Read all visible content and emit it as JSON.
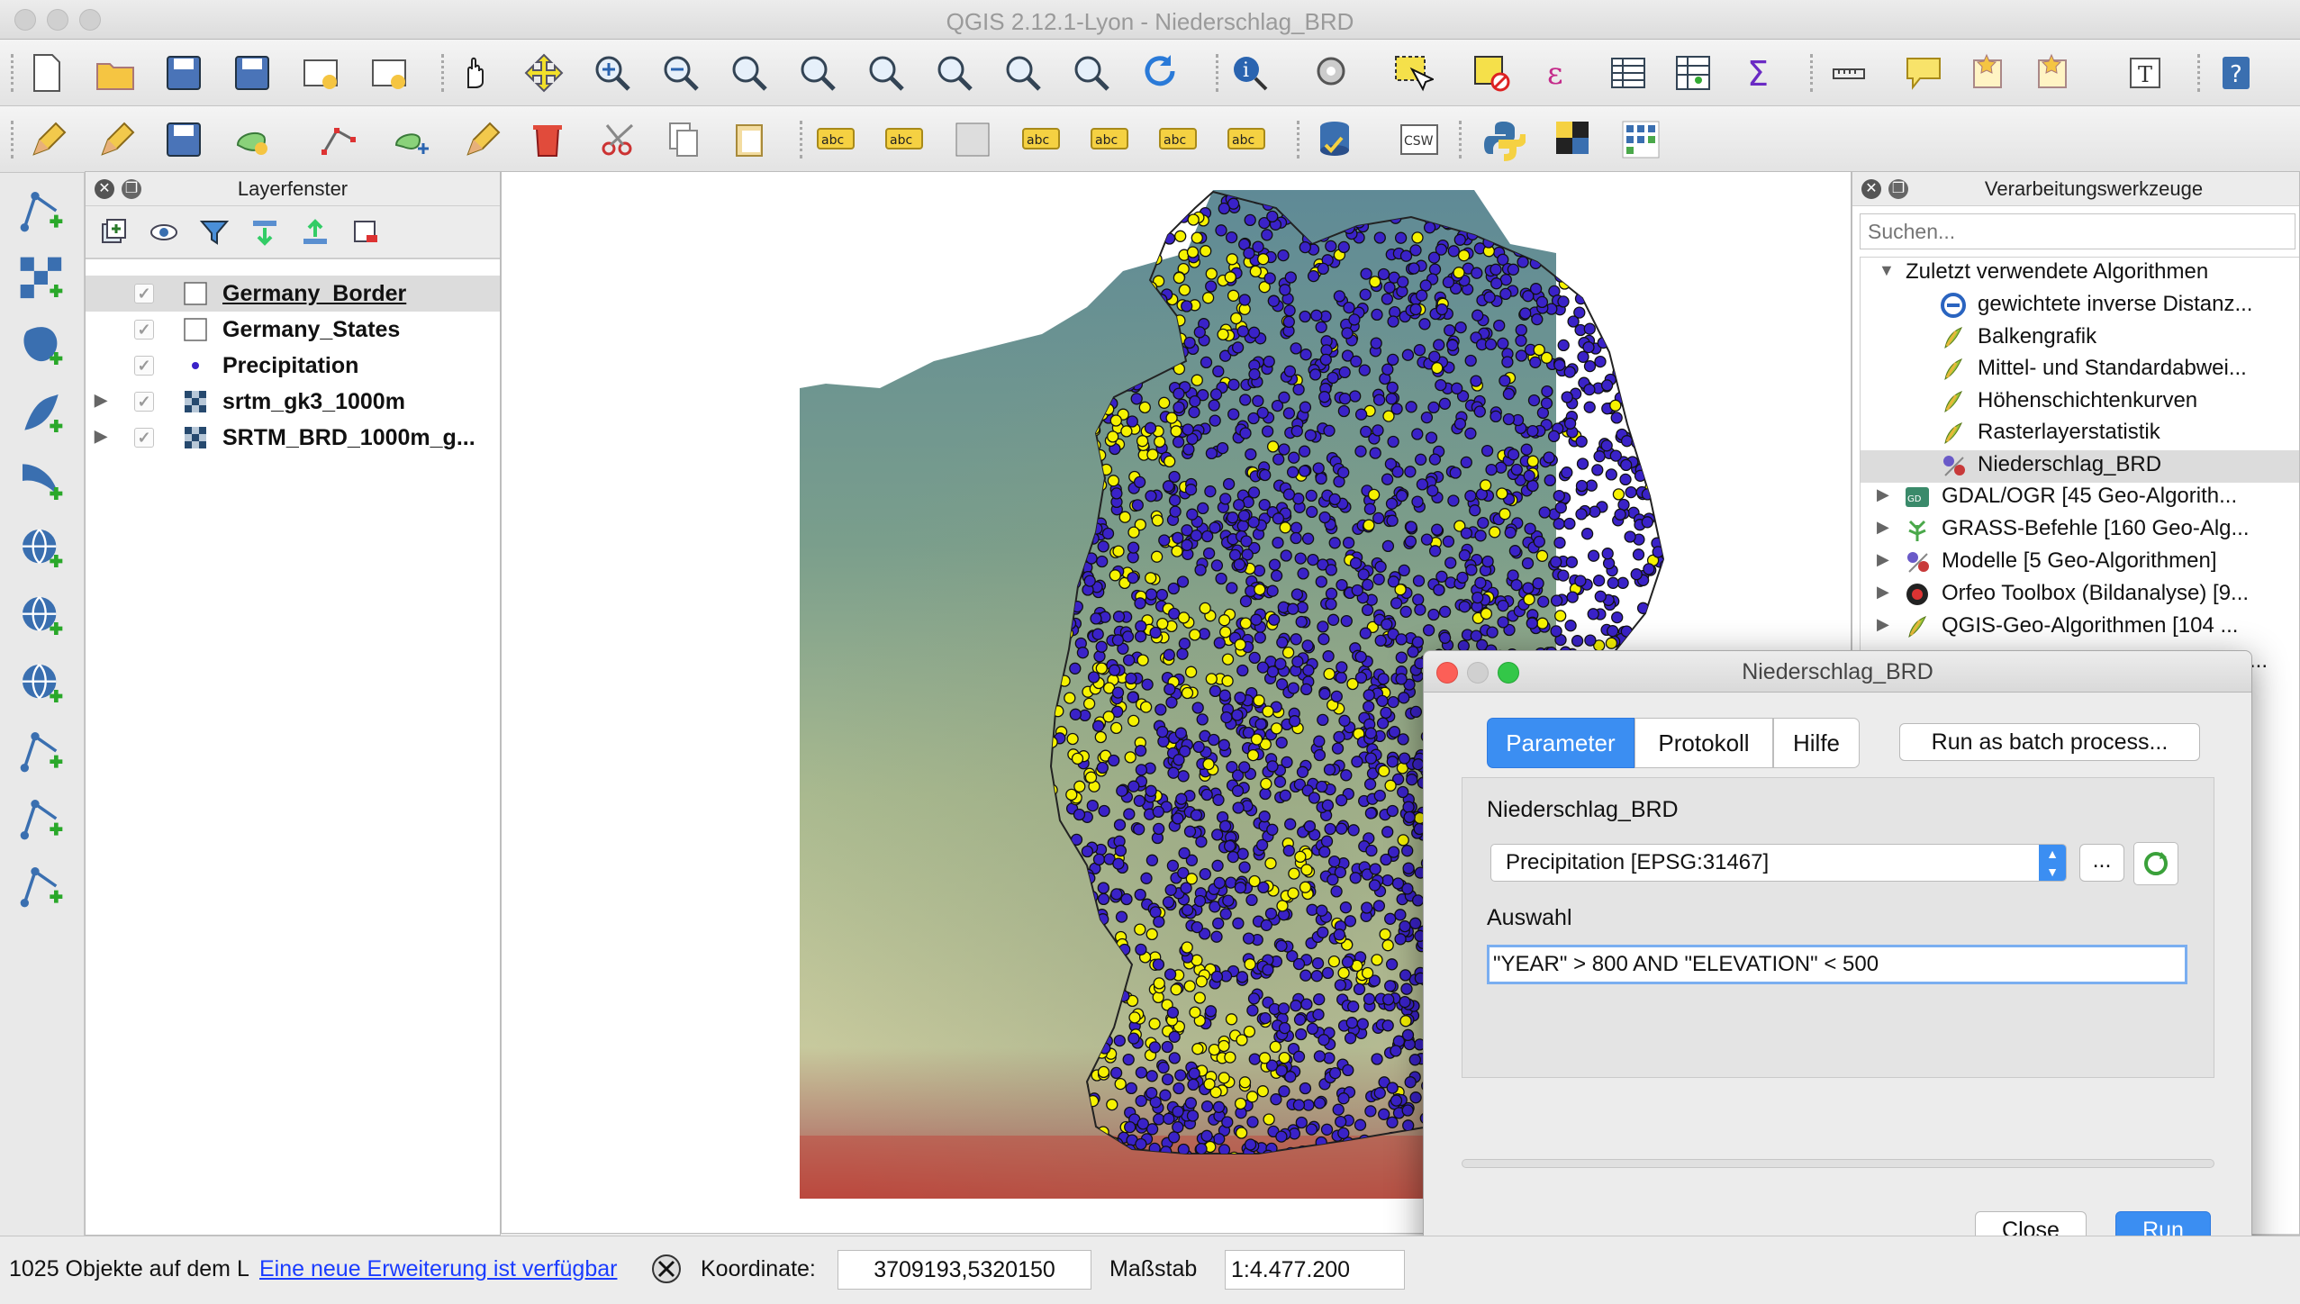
{
  "window": {
    "title": "QGIS 2.12.1-Lyon - Niederschlag_BRD"
  },
  "colors": {
    "accent_blue": "#3b8ef2",
    "point_fill": "#3a22c8",
    "point_selected": "#f6f200",
    "map_bg": "#ffffff"
  },
  "toolbar1": {
    "icons": [
      "new-project-icon",
      "open-project-icon",
      "save-project-icon",
      "save-as-icon",
      "new-print-composer-icon",
      "composer-manager-icon",
      "pan-icon",
      "pan-to-selection-icon",
      "zoom-in-icon",
      "zoom-out-icon",
      "zoom-actual-icon",
      "zoom-full-icon",
      "zoom-to-selection-icon",
      "zoom-to-layer-icon",
      "zoom-last-icon",
      "zoom-next-icon",
      "refresh-icon",
      "identify-icon",
      "run-feature-action-icon",
      "select-features-icon",
      "deselect-icon",
      "expression-select-icon",
      "attribute-table-icon",
      "field-calculator-icon",
      "statistics-icon",
      "measure-icon",
      "map-tips-icon",
      "new-bookmark-icon",
      "show-bookmarks-icon",
      "text-annotation-icon",
      "help-icon"
    ]
  },
  "toolbar2": {
    "icons": [
      "current-edits-icon",
      "toggle-editing-icon",
      "save-edits-icon",
      "add-feature-icon",
      "node-tool-icon",
      "move-feature-icon",
      "digitize-icon",
      "delete-selected-icon",
      "cut-features-icon",
      "copy-features-icon",
      "paste-features-icon",
      "label-tool-icon",
      "pin-labels-icon",
      "highlight-pinned-icon",
      "show-hide-labels-icon",
      "move-label-icon",
      "rotate-label-icon",
      "change-label-icon",
      "db-manager-icon",
      "csw-icon",
      "python-console-icon",
      "grid-plugin-icon",
      "netcdf-icon"
    ],
    "csw_label": "CSW"
  },
  "left_toolbar": {
    "icons": [
      "add-vector-layer-icon",
      "add-raster-layer-icon",
      "add-postgis-layer-icon",
      "add-spatialite-layer-icon",
      "add-mssql-layer-icon",
      "add-wms-layer-icon",
      "add-wfs-layer-icon",
      "add-wcs-layer-icon",
      "add-delimited-text-icon",
      "new-shapefile-icon",
      "add-virtual-layer-icon"
    ]
  },
  "layer_panel": {
    "title": "Layerfenster",
    "layers": [
      {
        "name": "Germany_Border",
        "checked": true,
        "selected": true,
        "expandable": false,
        "symbol": "polygon-empty"
      },
      {
        "name": "Germany_States",
        "checked": true,
        "selected": false,
        "expandable": false,
        "symbol": "polygon-empty"
      },
      {
        "name": "Precipitation",
        "checked": true,
        "selected": false,
        "expandable": false,
        "symbol": "point"
      },
      {
        "name": "srtm_gk3_1000m",
        "checked": true,
        "selected": false,
        "expandable": true,
        "symbol": "raster"
      },
      {
        "name": "SRTM_BRD_1000m_g...",
        "checked": true,
        "selected": false,
        "expandable": true,
        "symbol": "raster"
      }
    ]
  },
  "processing_panel": {
    "title": "Verarbeitungswerkzeuge",
    "search_placeholder": "Suchen...",
    "recent_group": "Zuletzt verwendete Algorithmen",
    "recent_items": [
      {
        "label": "gewichtete inverse Distanz...",
        "icon": "saga-icon"
      },
      {
        "label": "Balkengrafik",
        "icon": "qgis-algorithm-icon"
      },
      {
        "label": "Mittel- und Standardabwei...",
        "icon": "qgis-algorithm-icon"
      },
      {
        "label": "Höhenschichtenkurven",
        "icon": "qgis-algorithm-icon"
      },
      {
        "label": "Rasterlayerstatistik",
        "icon": "qgis-algorithm-icon"
      },
      {
        "label": "Niederschlag_BRD",
        "icon": "model-icon"
      }
    ],
    "groups": [
      {
        "label": "GDAL/OGR [45 Geo-Algorith...",
        "icon": "gdal-icon"
      },
      {
        "label": "GRASS-Befehle [160 Geo-Alg...",
        "icon": "grass-icon"
      },
      {
        "label": "Modelle [5 Geo-Algorithmen]",
        "icon": "model-icon"
      },
      {
        "label": "Orfeo Toolbox (Bildanalyse) [9...",
        "icon": "orfeo-icon"
      },
      {
        "label": "QGIS-Geo-Algorithmen [104 ...",
        "icon": "qgis-algorithm-icon"
      }
    ],
    "peek_text": "it..."
  },
  "dialog": {
    "title": "Niederschlag_BRD",
    "tabs": [
      "Parameter",
      "Protokoll",
      "Hilfe"
    ],
    "active_tab": "Parameter",
    "batch_button": "Run as batch process...",
    "layer_label": "Niederschlag_BRD",
    "layer_value": "Precipitation [EPSG:31467]",
    "browse_button": "...",
    "selection_label": "Auswahl",
    "selection_value": "\"YEAR\" > 800 AND \"ELEVATION\"  < 500",
    "progress": 0,
    "close_button": "Close",
    "run_button": "Run"
  },
  "status_bar": {
    "message": "1025 Objekte auf dem L",
    "update_link": "Eine neue Erweiterung ist verfügbar",
    "coord_label": "Koordinate:",
    "coord_value": "3709193,5320150",
    "scale_label": "Maßstab",
    "scale_value": "1:4.477.200"
  }
}
